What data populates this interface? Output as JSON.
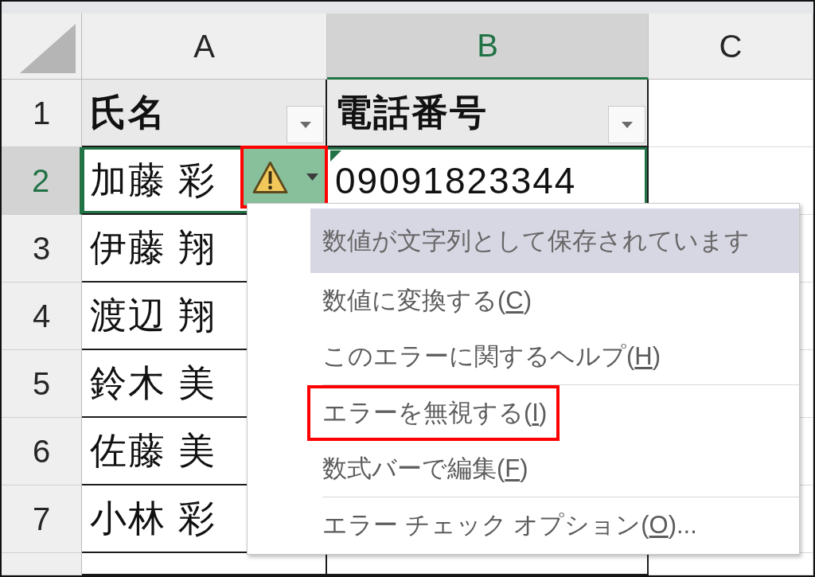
{
  "columns": [
    {
      "label": "A",
      "selected": false
    },
    {
      "label": "B",
      "selected": true
    },
    {
      "label": "C",
      "selected": false
    }
  ],
  "rows": [
    {
      "number": "1",
      "selected": false,
      "cells": [
        {
          "kind": "header",
          "text": "氏名",
          "filter": true,
          "selected": false
        },
        {
          "kind": "header",
          "text": "電話番号",
          "filter": true,
          "selected": false
        }
      ]
    },
    {
      "number": "2",
      "selected": true,
      "cells": [
        {
          "kind": "data",
          "text": "加藤 彩",
          "selected": true,
          "error": false
        },
        {
          "kind": "data",
          "text": "09091823344",
          "selected": true,
          "error": true
        }
      ]
    },
    {
      "number": "3",
      "selected": false,
      "cells": [
        {
          "kind": "data",
          "text": "伊藤 翔",
          "selected": false,
          "error": false
        }
      ]
    },
    {
      "number": "4",
      "selected": false,
      "cells": [
        {
          "kind": "data",
          "text": "渡辺 翔",
          "selected": false,
          "error": false
        }
      ]
    },
    {
      "number": "5",
      "selected": false,
      "cells": [
        {
          "kind": "data",
          "text": "鈴木 美",
          "selected": false,
          "error": false
        }
      ]
    },
    {
      "number": "6",
      "selected": false,
      "cells": [
        {
          "kind": "data",
          "text": "佐藤 美",
          "selected": false,
          "error": false
        }
      ]
    },
    {
      "number": "7",
      "selected": false,
      "cells": [
        {
          "kind": "data",
          "text": "小林 彩",
          "selected": false,
          "error": false
        }
      ]
    }
  ],
  "smart_tag": {
    "callout": true
  },
  "menu": {
    "title": "数値が文字列として保存されています",
    "items": [
      {
        "label": "数値に変換する(",
        "access_key": "C",
        "suffix": ")",
        "separator_before": false,
        "callout": false
      },
      {
        "label": "このエラーに関するヘルプ(",
        "access_key": "H",
        "suffix": ")",
        "separator_before": false,
        "callout": false
      },
      {
        "label": "エラーを無視する(",
        "access_key": "I",
        "suffix": ")",
        "separator_before": true,
        "callout": true
      },
      {
        "label": "数式バーで編集(",
        "access_key": "F",
        "suffix": ")",
        "separator_before": false,
        "callout": false
      },
      {
        "label": "エラー チェック オプション(",
        "access_key": "O",
        "suffix": ")...",
        "separator_before": true,
        "callout": false
      }
    ]
  }
}
